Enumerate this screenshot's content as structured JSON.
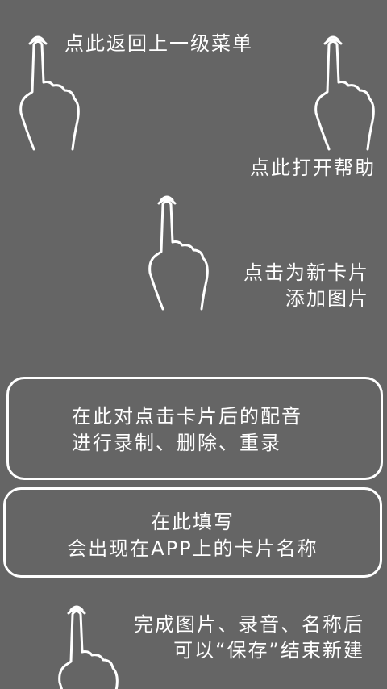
{
  "hints": {
    "back": "点此返回上一级菜单",
    "help": "点此打开帮助",
    "new_card_line1": "点击为新卡片",
    "new_card_line2": "添加图片",
    "finish_line1": "完成图片、录音、名称后",
    "finish_line2": "可以“保存”结束新建"
  },
  "panels": {
    "audio": {
      "line1": "在此对点击卡片后的配音",
      "line2": "进行录制、删除、重录"
    },
    "name": {
      "line1": "在此填写",
      "line2": "会出现在APP上的卡片名称"
    }
  },
  "icons": {
    "hand": "pointing-hand-icon"
  },
  "colors": {
    "background": "#656565",
    "foreground": "#ffffff"
  }
}
